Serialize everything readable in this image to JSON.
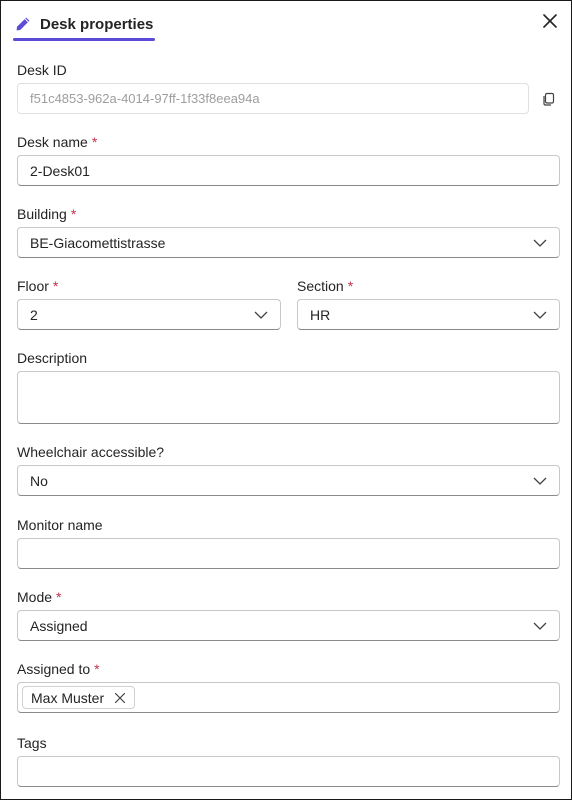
{
  "header": {
    "title": "Desk properties",
    "accent_color": "#5b4bd6",
    "edit_icon": "pencil-icon",
    "close_icon": "close-icon"
  },
  "fields": {
    "desk_id": {
      "label": "Desk ID",
      "value": "f51c4853-962a-4014-97ff-1f33f8eea94a",
      "copy_icon": "copy-icon"
    },
    "desk_name": {
      "label": "Desk name",
      "required": "*",
      "value": "2-Desk01"
    },
    "building": {
      "label": "Building",
      "required": "*",
      "value": "BE-Giacomettistrasse"
    },
    "floor": {
      "label": "Floor",
      "required": "*",
      "value": "2"
    },
    "section": {
      "label": "Section",
      "required": "*",
      "value": "HR"
    },
    "description": {
      "label": "Description",
      "value": ""
    },
    "wheelchair": {
      "label": "Wheelchair accessible?",
      "value": "No"
    },
    "monitor_name": {
      "label": "Monitor name",
      "value": ""
    },
    "mode": {
      "label": "Mode",
      "required": "*",
      "value": "Assigned"
    },
    "assigned_to": {
      "label": "Assigned to",
      "required": "*",
      "chips": [
        "Max Muster"
      ]
    },
    "tags": {
      "label": "Tags",
      "value": ""
    }
  },
  "colors": {
    "required": "#c4314b",
    "border": "#c8c8c8"
  }
}
